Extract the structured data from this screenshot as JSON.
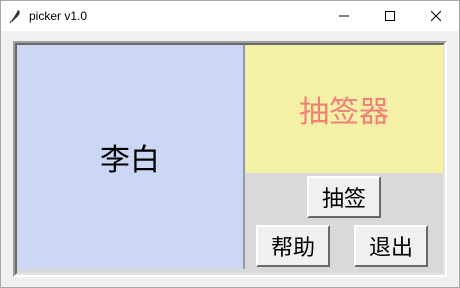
{
  "window": {
    "title": "picker v1.0",
    "icon": "feather-icon"
  },
  "panels": {
    "name": "李白",
    "title": "抽签器"
  },
  "buttons": {
    "draw": "抽签",
    "help": "帮助",
    "exit": "退出"
  },
  "colors": {
    "name_panel_bg": "#ccd6f5",
    "title_panel_bg": "#f4f0a6",
    "title_text": "#f08078"
  }
}
